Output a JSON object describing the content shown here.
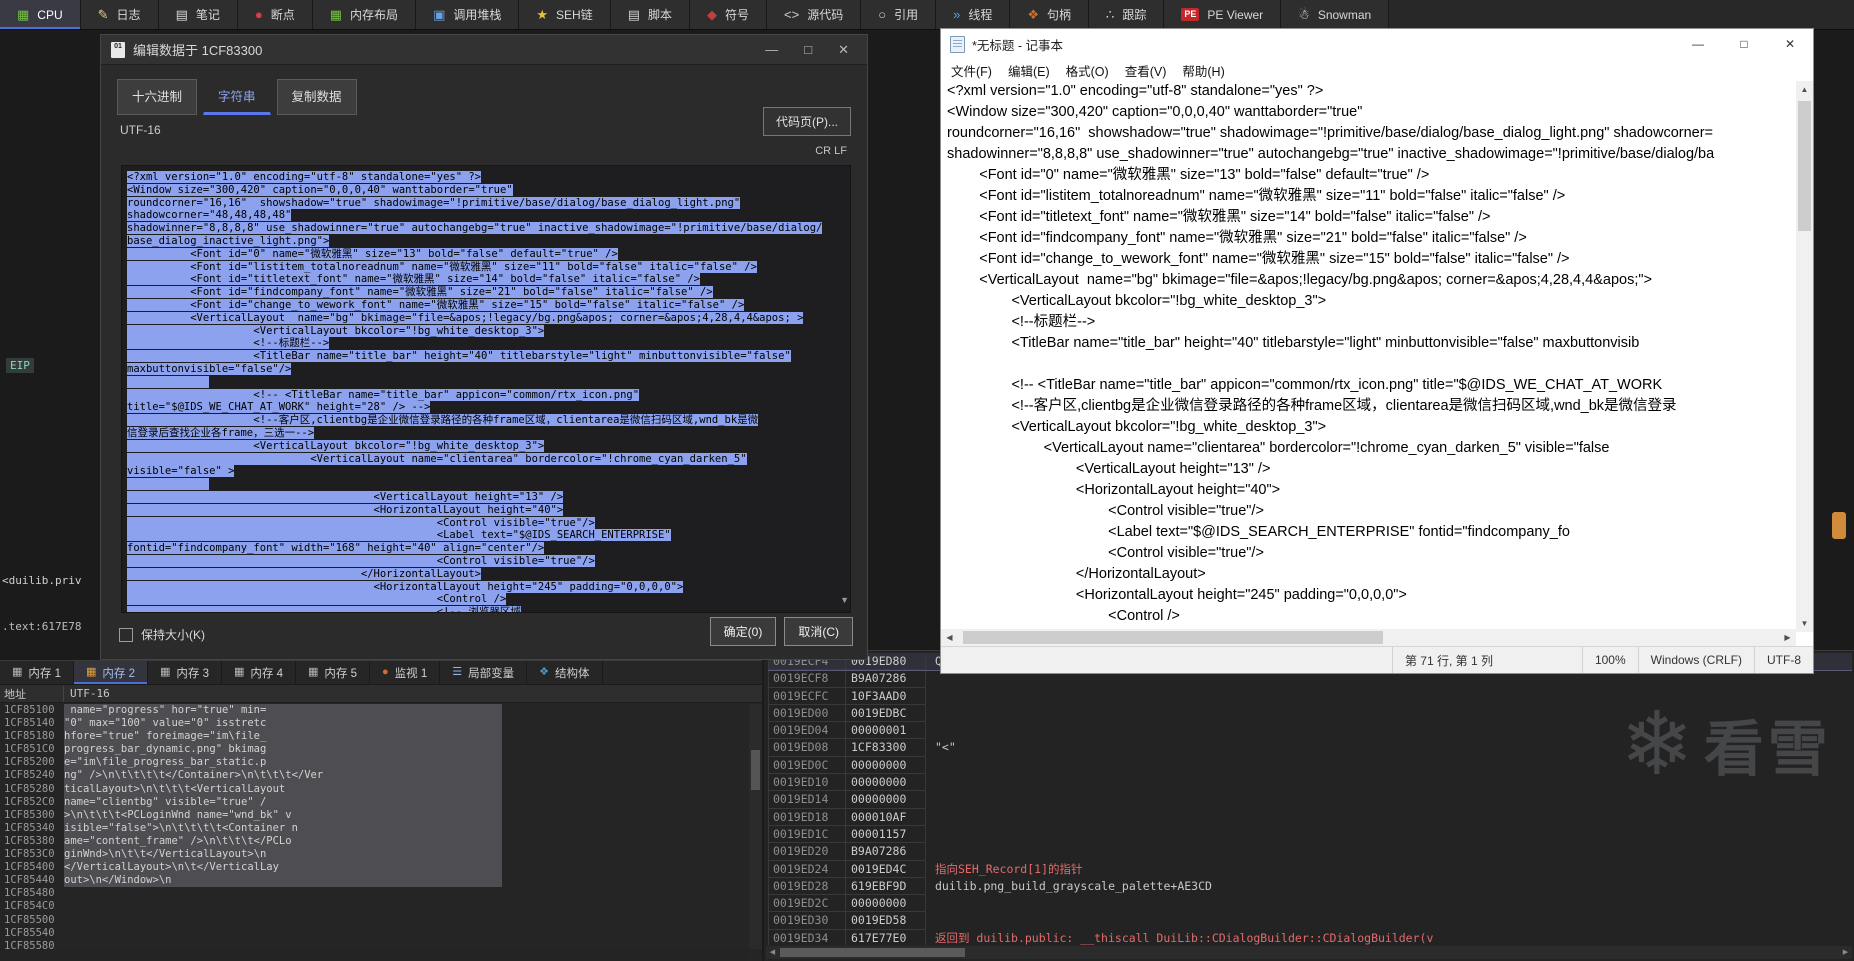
{
  "colors": {
    "accent": "#4a6fd8",
    "selection": "#8ca2ee",
    "annotation_red": "#e46a6a",
    "active_tab_bg": "#3a3a44"
  },
  "icons": {
    "scroll_up": "▲",
    "scroll_down": "▼",
    "scroll_left": "◀",
    "scroll_right": "▶"
  },
  "toolbar": {
    "tabs": [
      {
        "label": "CPU",
        "icon": "▦",
        "color": "#76c043",
        "active": true
      },
      {
        "label": "日志",
        "icon": "✎",
        "color": "#e0cfa0"
      },
      {
        "label": "笔记",
        "icon": "▤",
        "color": "#d8d8d8"
      },
      {
        "label": "断点",
        "icon": "●",
        "color": "#d84040"
      },
      {
        "label": "内存布局",
        "icon": "▦",
        "color": "#76c043"
      },
      {
        "label": "调用堆栈",
        "icon": "▣",
        "color": "#6aa0e0"
      },
      {
        "label": "SEH链",
        "icon": "★",
        "color": "#e8c23a"
      },
      {
        "label": "脚本",
        "icon": "▤",
        "color": "#d0d0d0"
      },
      {
        "label": "符号",
        "icon": "◆",
        "color": "#c04040"
      },
      {
        "label": "源代码",
        "icon": "<>",
        "color": "#cfcfcf"
      },
      {
        "label": "引用",
        "icon": "○",
        "color": "#d0d0d0"
      },
      {
        "label": "线程",
        "icon": "»",
        "color": "#5aa0e8"
      },
      {
        "label": "句柄",
        "icon": "❖",
        "color": "#c87030"
      },
      {
        "label": "跟踪",
        "icon": "∴",
        "color": "#d8d8d8"
      },
      {
        "label": "PE Viewer",
        "icon": "PE",
        "color": "#ffffff",
        "cls": "pe"
      },
      {
        "label": "Snowman",
        "icon": "☃",
        "color": "#f0f0f0"
      }
    ]
  },
  "debugger_fragments": {
    "eip": "EIP",
    "sym1": "<duilib.priv",
    "sym2": ".text:617E78"
  },
  "edit_dialog": {
    "title": "编辑数据于  1CF83300",
    "icon_text": "01",
    "window_buttons": {
      "minimize": "—",
      "maximize": "□",
      "close": "✕"
    },
    "tabs": [
      {
        "label": "十六进制"
      },
      {
        "label": "字符串",
        "active": true
      },
      {
        "label": "复制数据"
      }
    ],
    "encoding_label": "UTF-16",
    "codepage_button": "代码页(P)...",
    "crlf_label": "CR LF",
    "keep_size_label": "保持大小(K)",
    "ok_label": "确定(0)",
    "cancel_label": "取消(C)",
    "lines": [
      "<?xml version=\"1.0\" encoding=\"utf-8\" standalone=\"yes\" ?>",
      "<Window size=\"300,420\" caption=\"0,0,0,40\" wanttaborder=\"true\"",
      "roundcorner=\"16,16\"  showshadow=\"true\" shadowimage=\"!primitive/base/dialog/base_dialog_light.png\"",
      "shadowcorner=\"48,48,48,48\"",
      "shadowinner=\"8,8,8,8\" use_shadowinner=\"true\" autochangebg=\"true\" inactive_shadowimage=\"!primitive/base/dialog/",
      "base_dialog_inactive_light.png\">",
      "          <Font id=\"0\" name=\"微软雅黑\" size=\"13\" bold=\"false\" default=\"true\" />",
      "          <Font id=\"listitem_totalnoreadnum\" name=\"微软雅黑\" size=\"11\" bold=\"false\" italic=\"false\" />",
      "          <Font id=\"titletext_font\" name=\"微软雅黑\" size=\"14\" bold=\"false\" italic=\"false\" />",
      "          <Font id=\"findcompany_font\" name=\"微软雅黑\" size=\"21\" bold=\"false\" italic=\"false\" />",
      "          <Font id=\"change_to_wework_font\" name=\"微软雅黑\" size=\"15\" bold=\"false\" italic=\"false\" />",
      "          <VerticalLayout  name=\"bg\" bkimage=\"file=&apos;!legacy/bg.png&apos; corner=&apos;4,28,4,4&apos; >",
      "                    <VerticalLayout bkcolor=\"!bg_white_desktop_3\">",
      "                    <!--标题栏-->",
      "                    <TitleBar name=\"title_bar\" height=\"40\" titlebarstyle=\"light\" minbuttonvisible=\"false\"",
      "maxbuttonvisible=\"false\"/>",
      "             ",
      "                    <!-- <TitleBar name=\"title_bar\" appicon=\"common/rtx_icon.png\"",
      "title=\"$@IDS_WE_CHAT_AT_WORK\" height=\"28\" /> -->",
      "                    <!--客户区,clientbg是企业微信登录路径的各种frame区域，clientarea是微信扫码区域,wnd_bk是微",
      "信登录后查找企业各frame，三选一-->",
      "                    <VerticalLayout bkcolor=\"!bg_white_desktop_3\">",
      "                             <VerticalLayout name=\"clientarea\" bordercolor=\"!chrome_cyan_darken_5\"",
      "visible=\"false\" >",
      "             ",
      "                                       <VerticalLayout height=\"13\" />",
      "                                       <HorizontalLayout height=\"40\">",
      "                                                 <Control visible=\"true\"/>",
      "                                                 <Label text=\"$@IDS_SEARCH_ENTERPRISE\"",
      "fontid=\"findcompany_font\" width=\"168\" height=\"40\" align=\"center\"/>",
      "                                                 <Control visible=\"true\"/>",
      "                                     </HorizontalLayout>",
      "                                       <HorizontalLayout height=\"245\" padding=\"0,0,0,0\">",
      "                                                 <Control />",
      "                                                 <!-- 浏览器区域"
    ]
  },
  "notepad": {
    "title": "*无标题 - 记事本",
    "window_buttons": {
      "minimize": "—",
      "maximize": "□",
      "close": "✕"
    },
    "menus": [
      "文件(F)",
      "编辑(E)",
      "格式(O)",
      "查看(V)",
      "帮助(H)"
    ],
    "status": {
      "position": "第 71 行, 第 1 列",
      "zoom": "100%",
      "line_ending": "Windows (CRLF)",
      "encoding": "UTF-8"
    },
    "lines": [
      "<?xml version=\"1.0\" encoding=\"utf-8\" standalone=\"yes\" ?>",
      "<Window size=\"300,420\" caption=\"0,0,0,40\" wanttaborder=\"true\"",
      "roundcorner=\"16,16\"  showshadow=\"true\" shadowimage=\"!primitive/base/dialog/base_dialog_light.png\" shadowcorner=",
      "shadowinner=\"8,8,8,8\" use_shadowinner=\"true\" autochangebg=\"true\" inactive_shadowimage=\"!primitive/base/dialog/ba",
      "        <Font id=\"0\" name=\"微软雅黑\" size=\"13\" bold=\"false\" default=\"true\" />",
      "        <Font id=\"listitem_totalnoreadnum\" name=\"微软雅黑\" size=\"11\" bold=\"false\" italic=\"false\" />",
      "        <Font id=\"titletext_font\" name=\"微软雅黑\" size=\"14\" bold=\"false\" italic=\"false\" />",
      "        <Font id=\"findcompany_font\" name=\"微软雅黑\" size=\"21\" bold=\"false\" italic=\"false\" />",
      "        <Font id=\"change_to_wework_font\" name=\"微软雅黑\" size=\"15\" bold=\"false\" italic=\"false\" />",
      "        <VerticalLayout  name=\"bg\" bkimage=\"file=&apos;!legacy/bg.png&apos; corner=&apos;4,28,4,4&apos;\">",
      "                <VerticalLayout bkcolor=\"!bg_white_desktop_3\">",
      "                <!--标题栏-->",
      "                <TitleBar name=\"title_bar\" height=\"40\" titlebarstyle=\"light\" minbuttonvisible=\"false\" maxbuttonvisib",
      "",
      "                <!-- <TitleBar name=\"title_bar\" appicon=\"common/rtx_icon.png\" title=\"$@IDS_WE_CHAT_AT_WORK",
      "                <!--客户区,clientbg是企业微信登录路径的各种frame区域，clientarea是微信扫码区域,wnd_bk是微信登录",
      "                <VerticalLayout bkcolor=\"!bg_white_desktop_3\">",
      "                        <VerticalLayout name=\"clientarea\" bordercolor=\"!chrome_cyan_darken_5\" visible=\"false",
      "                                <VerticalLayout height=\"13\" />",
      "                                <HorizontalLayout height=\"40\">",
      "                                        <Control visible=\"true\"/>",
      "                                        <Label text=\"$@IDS_SEARCH_ENTERPRISE\" fontid=\"findcompany_fo",
      "                                        <Control visible=\"true\"/>",
      "                                </HorizontalLayout>",
      "                                <HorizontalLayout height=\"245\" padding=\"0,0,0,0\">",
      "                                        <Control />"
    ]
  },
  "memory_panel": {
    "tabs": [
      {
        "label": "内存 1",
        "icon": "▦",
        "color": "#b8b8b8"
      },
      {
        "label": "内存 2",
        "icon": "▦",
        "color": "#e8a03a",
        "active": true
      },
      {
        "label": "内存 3",
        "icon": "▦",
        "color": "#b8b8b8"
      },
      {
        "label": "内存 4",
        "icon": "▦",
        "color": "#b8b8b8"
      },
      {
        "label": "内存 5",
        "icon": "▦",
        "color": "#b8b8b8"
      },
      {
        "label": "监视 1",
        "icon": "●",
        "color": "#d07030"
      },
      {
        "label": "局部变量",
        "icon": "☰",
        "color": "#8fb8e8"
      },
      {
        "label": "结构体",
        "icon": "❖",
        "color": "#4898c8"
      }
    ],
    "columns": {
      "address": "地址",
      "data": "UTF-16"
    },
    "rows": [
      {
        "a": "1CF85100",
        "t": " name=\"progress\" hor=\"true\" min=",
        "cls": "sel"
      },
      {
        "a": "1CF85140",
        "t": "\"0\" max=\"100\" value=\"0\" isstretc",
        "cls": "sel"
      },
      {
        "a": "1CF85180",
        "t": "hfore=\"true\" foreimage=\"im\\file_",
        "cls": "sel"
      },
      {
        "a": "1CF851C0",
        "t": "progress_bar_dynamic.png\" bkimag",
        "cls": "sel"
      },
      {
        "a": "1CF85200",
        "t": "e=\"im\\file_progress_bar_static.p",
        "cls": "sel"
      },
      {
        "a": "1CF85240",
        "t": "ng\" />\\n\\t\\t\\t\\t</Container>\\n\\t\\t\\t</Ver",
        "cls": "sel"
      },
      {
        "a": "1CF85280",
        "t": "ticalLayout>\\n\\t\\t\\t<VerticalLayout ",
        "cls": "sel"
      },
      {
        "a": "1CF852C0",
        "t": "name=\"clientbg\" visible=\"true\" /",
        "cls": "sel"
      },
      {
        "a": "1CF85300",
        "t": ">\\n\\t\\t\\t<PCLoginWnd name=\"wnd_bk\" v",
        "cls": "sel"
      },
      {
        "a": "1CF85340",
        "t": "isible=\"false\">\\n\\t\\t\\t\\t<Container n",
        "cls": "sel"
      },
      {
        "a": "1CF85380",
        "t": "ame=\"content_frame\" />\\n\\t\\t\\t</PCLo",
        "cls": "sel"
      },
      {
        "a": "1CF853C0",
        "t": "ginWnd>\\n\\t\\t</VerticalLayout>\\n",
        "cls": "sel"
      },
      {
        "a": "1CF85400",
        "t": "</VerticalLayout>\\n\\t</VerticalLay",
        "cls": "sel"
      },
      {
        "a": "1CF85440",
        "t": "out>\\n</Window>\\n",
        "cls": "sel"
      },
      {
        "a": "1CF85480",
        "t": ""
      },
      {
        "a": "1CF854C0",
        "t": ""
      },
      {
        "a": "1CF85500",
        "t": ""
      },
      {
        "a": "1CF85540",
        "t": ""
      },
      {
        "a": "1CF85580",
        "t": ""
      },
      {
        "a": "1CF855C0",
        "t": ""
      }
    ]
  },
  "stack_panel": {
    "rows": [
      {
        "a": "0019ECF4",
        "v": "0019ED80",
        "n": "Q <",
        "cls": "top"
      },
      {
        "a": "0019ECF8",
        "v": "B9A07286",
        "n": ""
      },
      {
        "a": "0019ECFC",
        "v": "10F3AAD0",
        "n": ""
      },
      {
        "a": "0019ED00",
        "v": "0019EDBC",
        "n": ""
      },
      {
        "a": "0019ED04",
        "v": "00000001",
        "n": ""
      },
      {
        "a": "0019ED08",
        "v": "1CF83300",
        "n": "\"<\""
      },
      {
        "a": "0019ED0C",
        "v": "00000000",
        "n": ""
      },
      {
        "a": "0019ED10",
        "v": "00000000",
        "n": ""
      },
      {
        "a": "0019ED14",
        "v": "00000000",
        "n": ""
      },
      {
        "a": "0019ED18",
        "v": "000010AF",
        "n": ""
      },
      {
        "a": "0019ED1C",
        "v": "00001157",
        "n": ""
      },
      {
        "a": "0019ED20",
        "v": "B9A07286",
        "n": ""
      },
      {
        "a": "0019ED24",
        "v": "0019ED4C",
        "n": "指向SEH_Record[1]的指针",
        "nc": "red"
      },
      {
        "a": "0019ED28",
        "v": "619EBF9D",
        "n": "duilib.png_build_grayscale_palette+AE3CD"
      },
      {
        "a": "0019ED2C",
        "v": "00000000",
        "n": ""
      },
      {
        "a": "0019ED30",
        "v": "0019ED58",
        "n": ""
      },
      {
        "a": "0019ED34",
        "v": "617E77E0",
        "n": "返回到 duilib.public: __thiscall DuiLib::CDialogBuilder::CDialogBuilder(v",
        "nc": "red"
      }
    ]
  },
  "watermark": {
    "flake": "❄",
    "text": "看雪"
  }
}
